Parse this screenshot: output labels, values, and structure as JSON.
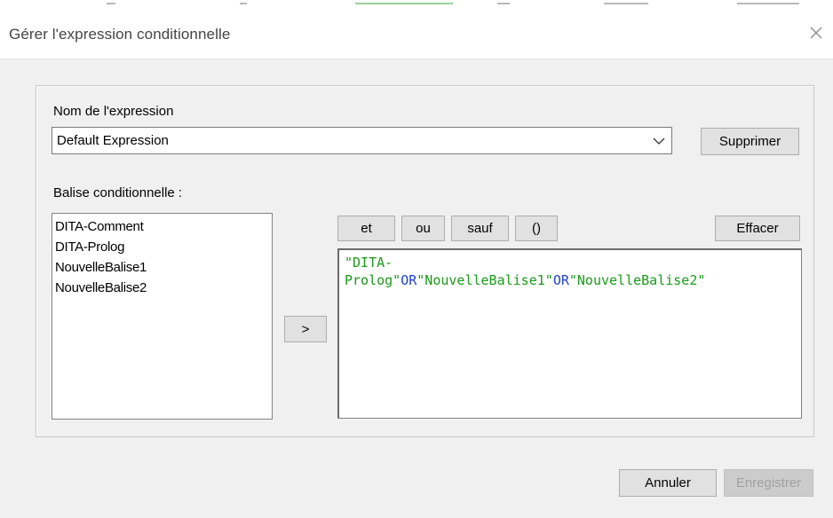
{
  "window": {
    "title": "Gérer l'expression conditionnelle"
  },
  "expression_name": {
    "label": "Nom de l'expression",
    "value": "Default Expression",
    "delete_button": "Supprimer"
  },
  "tags": {
    "label": "Balise conditionnelle :",
    "items": [
      "DITA-Comment",
      "DITA-Prolog",
      "NouvelleBalise1",
      "NouvelleBalise2"
    ],
    "add_button": ">"
  },
  "operators": {
    "and": "et",
    "or": "ou",
    "except": "sauf",
    "parens": "()",
    "clear": "Effacer"
  },
  "expression": {
    "line1": "\"DITA-",
    "line2_str1": "Prolog\"",
    "op1": "OR",
    "str2": "\"NouvelleBalise1\"",
    "op2": "OR",
    "str3": "\"NouvelleBalise2\""
  },
  "footer": {
    "cancel": "Annuler",
    "save": "Enregistrer"
  },
  "colors": {
    "string_token": "#1a9a1a",
    "operator_token": "#1f3fd0"
  }
}
